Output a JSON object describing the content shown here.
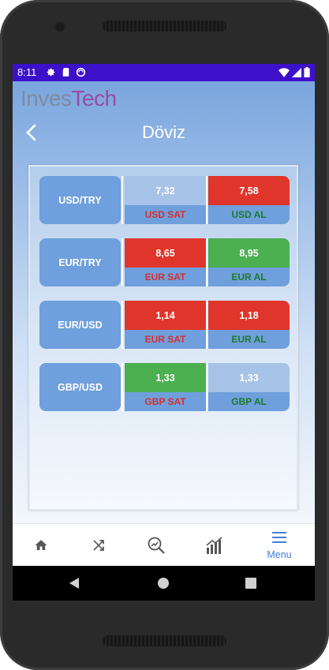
{
  "status_bar": {
    "time": "8:11",
    "icons_left": [
      "settings-icon",
      "sd-card-icon",
      "sync-icon"
    ],
    "icons_right": [
      "wifi-icon",
      "signal-icon",
      "battery-icon"
    ]
  },
  "brand": {
    "part1": "Inves",
    "part2": "Tech"
  },
  "header": {
    "title": "Döviz",
    "back_icon": "chevron-left-icon"
  },
  "colors": {
    "statusbar": "#3d10c9",
    "header_blue": "#7aa6de",
    "sell_red": "#e0352a",
    "buy_green": "#4caf50",
    "neutral_pale": "#a8c3e8",
    "label_blue": "#6f9fdc",
    "tab_active": "#3f7fd8"
  },
  "rates": [
    {
      "pair": "USD/TRY",
      "sell_value": "7,32",
      "sell_label": "USD SAT",
      "sell_state": "neutral",
      "buy_value": "7,58",
      "buy_label": "USD AL",
      "buy_state": "red"
    },
    {
      "pair": "EUR/TRY",
      "sell_value": "8,65",
      "sell_label": "EUR SAT",
      "sell_state": "red",
      "buy_value": "8,95",
      "buy_label": "EUR AL",
      "buy_state": "green"
    },
    {
      "pair": "EUR/USD",
      "sell_value": "1,14",
      "sell_label": "EUR SAT",
      "sell_state": "red",
      "buy_value": "1,18",
      "buy_label": "EUR AL",
      "buy_state": "red"
    },
    {
      "pair": "GBP/USD",
      "sell_value": "1,33",
      "sell_label": "GBP SAT",
      "sell_state": "green",
      "buy_value": "1,33",
      "buy_label": "GBP AL",
      "buy_state": "neutral"
    }
  ],
  "tabs": [
    {
      "icon": "home-icon",
      "label": ""
    },
    {
      "icon": "shuffle-icon",
      "label": ""
    },
    {
      "icon": "search-chart-icon",
      "label": ""
    },
    {
      "icon": "bar-chart-icon",
      "label": ""
    },
    {
      "icon": "menu-icon",
      "label": "Menu",
      "active": true
    }
  ],
  "navbar": {
    "icons": [
      "nav-back-icon",
      "nav-home-icon",
      "nav-recents-icon"
    ]
  }
}
